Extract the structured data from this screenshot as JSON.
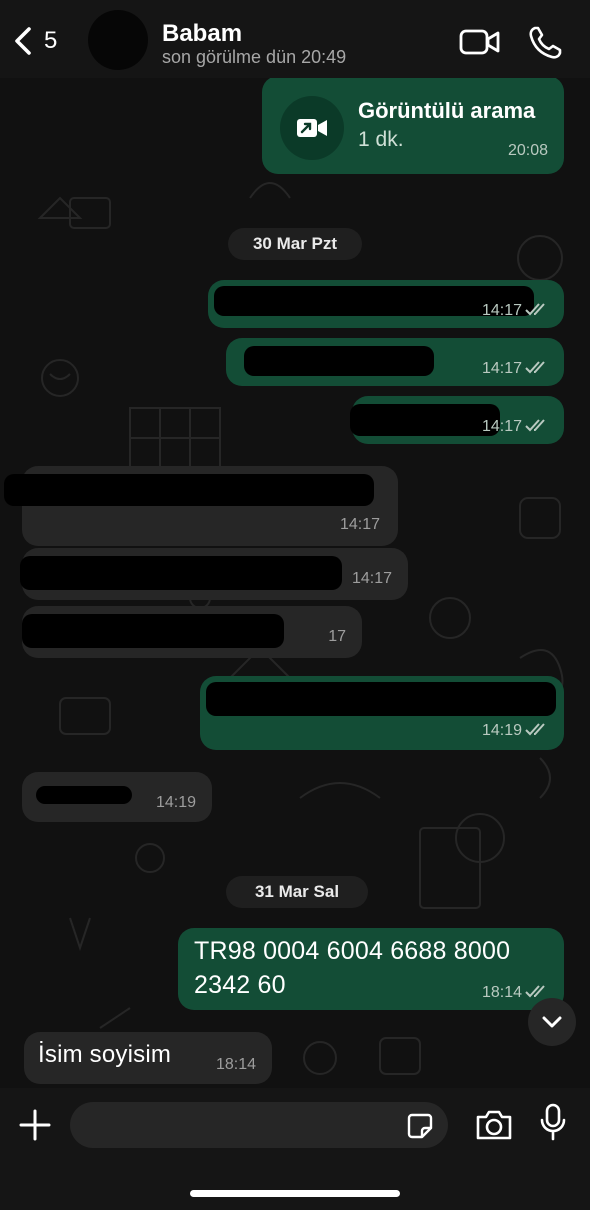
{
  "header": {
    "back_count": "5",
    "contact_name": "Babam",
    "status": "son görülme dün 20:49",
    "icons": [
      "chevron-left-icon",
      "video-camera-icon",
      "phone-icon"
    ]
  },
  "call": {
    "title": "Görüntülü arama",
    "duration": "1 dk.",
    "time": "20:08"
  },
  "dates": {
    "first": "30 Mar Pzt",
    "second": "31 Mar Sal"
  },
  "messages": {
    "m1_time": "14:17",
    "m2_time": "14:17",
    "m3_time": "14:17",
    "m4_time": "14:17",
    "m5_time": "14:17",
    "m6_time": "17",
    "m7_time": "14:19",
    "m8_time": "14:19",
    "iban_line1": "TR98 0004 6004 6688 8000",
    "iban_line2": "2342 60",
    "iban_time": "18:14",
    "last_text": "İsim soyisim",
    "last_time": "18:14"
  },
  "colors": {
    "outgoing_bubble": "#134d36",
    "incoming_bubble": "#262626",
    "background": "#111111",
    "read_ticks": "#b9c9c0"
  }
}
